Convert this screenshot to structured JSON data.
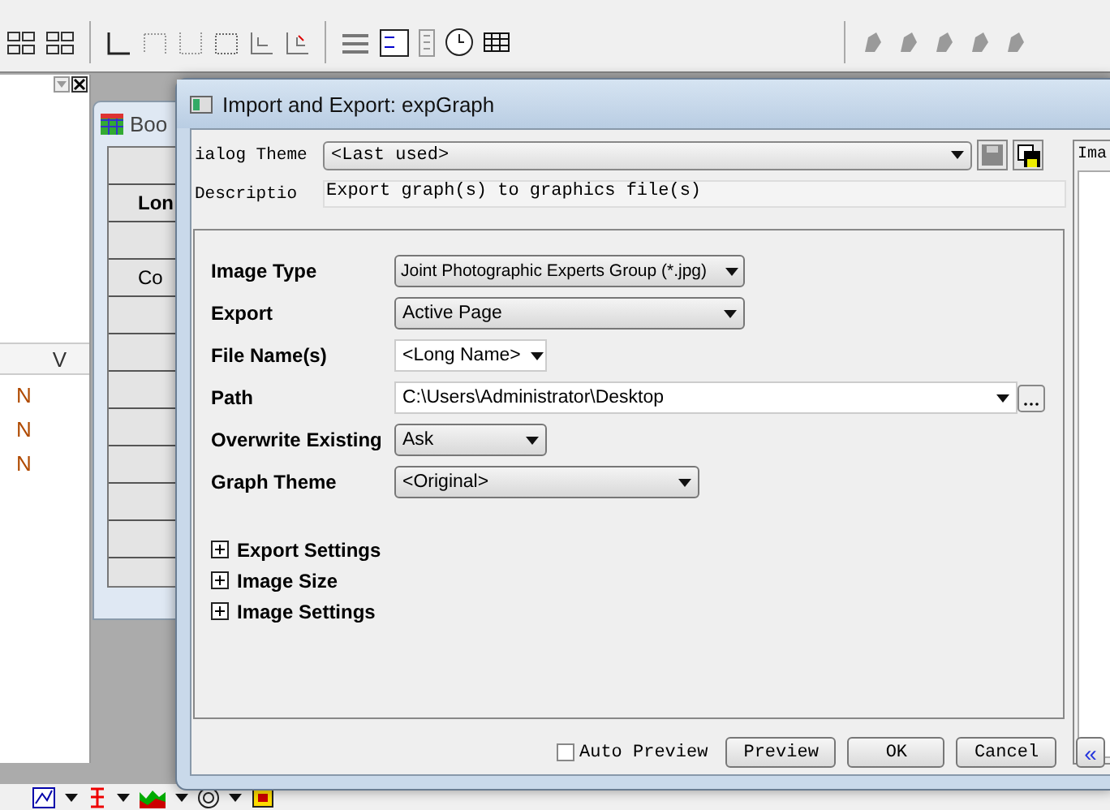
{
  "window": {
    "title": "Import and Export: expGraph"
  },
  "background": {
    "workbook_title": "Boo",
    "workbook_rows": [
      "Lon",
      "Co"
    ],
    "side_column": "V",
    "side_cells": [
      "N",
      "N",
      "N"
    ]
  },
  "dialog_theme": {
    "label": "ialog Theme",
    "value": "<Last used>"
  },
  "description": {
    "label": "Descriptio",
    "value": "Export graph(s) to graphics file(s)"
  },
  "fields": [
    {
      "label": "Image Type",
      "kind": "dropdown",
      "value": "Joint Photographic Experts Group (*.jpg)"
    },
    {
      "label": "Export",
      "kind": "dropdown",
      "value": "Active Page"
    },
    {
      "label": "File Name(s)",
      "kind": "combo",
      "value": "<Long Name>"
    },
    {
      "label": "Path",
      "kind": "path",
      "value": "C:\\Users\\Administrator\\Desktop"
    },
    {
      "label": "Overwrite Existing",
      "kind": "dropdown",
      "value": "Ask"
    },
    {
      "label": "Graph Theme",
      "kind": "dropdown",
      "value": "<Original>"
    }
  ],
  "sections": [
    {
      "label": "Export Settings",
      "expanded": false
    },
    {
      "label": "Image Size",
      "expanded": false
    },
    {
      "label": "Image Settings",
      "expanded": false
    }
  ],
  "preview_panel": {
    "label": "Ima"
  },
  "auto_preview": {
    "label": "Auto Preview",
    "checked": false
  },
  "buttons": [
    {
      "label": "Preview",
      "kind": "text"
    },
    {
      "label": "OK",
      "kind": "text"
    },
    {
      "label": "Cancel",
      "kind": "text"
    },
    {
      "label": "«",
      "kind": "glyph"
    }
  ]
}
